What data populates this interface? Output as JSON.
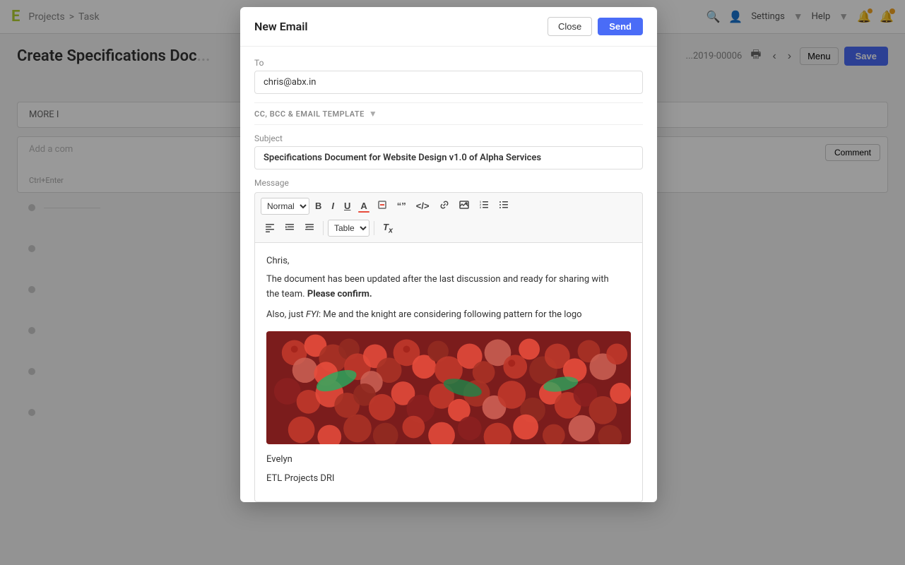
{
  "navbar": {
    "logo": "E",
    "breadcrumb": {
      "projects": "Projects",
      "separator1": ">",
      "task": "Task"
    },
    "settings_label": "Settings",
    "help_label": "Help"
  },
  "page": {
    "title": "Create Specifications Doc",
    "doc_id": "2019-00006",
    "menu_label": "Menu",
    "save_label": "Save"
  },
  "content": {
    "more_info_label": "MORE I",
    "comment_placeholder": "Add a com",
    "comment_btn": "Comment",
    "ctrl_hint": "Ctrl+Enter"
  },
  "modal": {
    "title": "New Email",
    "close_label": "Close",
    "send_label": "Send",
    "to_label": "To",
    "to_value": "chris@abx.in",
    "cc_bcc_label": "CC, BCC & EMAIL TEMPLATE",
    "subject_label": "Subject",
    "subject_value": "Specifications Document for Website Design v1.0 of Alpha Services",
    "message_label": "Message",
    "toolbar": {
      "format_select": "Normal",
      "bold": "B",
      "italic": "I",
      "underline": "U",
      "table_label": "Table"
    },
    "message_body": {
      "greeting": "Chris,",
      "line1": "The document has been updated after the last discussion and ready for sharing with",
      "line1b": "the team.",
      "bold_confirm": "Please confirm.",
      "line2_prefix": "Also, just",
      "line2_italic": "FYI",
      "line2_suffix": ": Me and the knight are considering following pattern for the logo"
    },
    "signature": {
      "name": "Evelyn",
      "title": "ETL Projects DRI"
    }
  }
}
